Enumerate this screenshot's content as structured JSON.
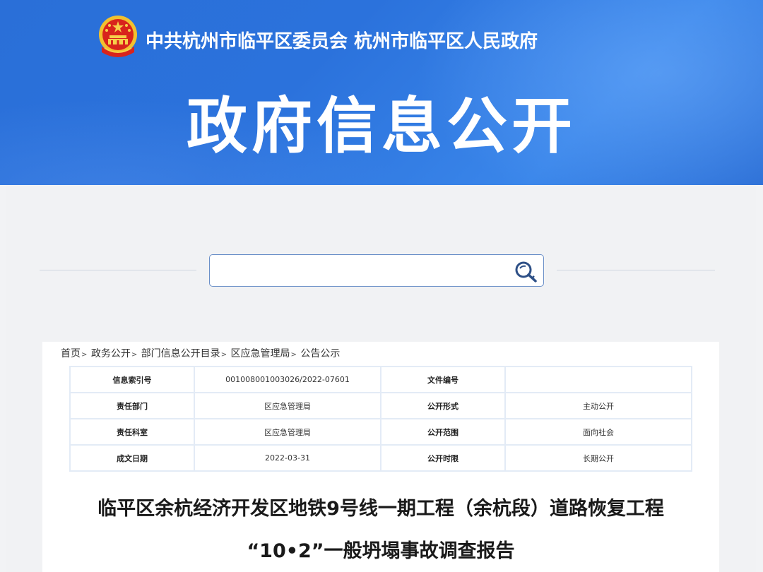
{
  "header": {
    "org_title": "中共杭州市临平区委员会  杭州市临平区人民政府",
    "main_title": "政府信息公开",
    "emblem_icon": "national-emblem-icon"
  },
  "search": {
    "value": "",
    "placeholder": "",
    "button_icon": "search-key-icon"
  },
  "breadcrumb": {
    "items": [
      "首页",
      "政务公开",
      "部门信息公开目录",
      "区应急管理局",
      "公告公示"
    ],
    "separator": ">"
  },
  "meta": {
    "rows": [
      {
        "label1": "信息索引号",
        "value1": "001008001003026/2022-07601",
        "label2": "文件编号",
        "value2": ""
      },
      {
        "label1": "责任部门",
        "value1": "区应急管理局",
        "label2": "公开形式",
        "value2": "主动公开"
      },
      {
        "label1": "责任科室",
        "value1": "区应急管理局",
        "label2": "公开范围",
        "value2": "面向社会"
      },
      {
        "label1": "成文日期",
        "value1": "2022-03-31",
        "label2": "公开时限",
        "value2": "长期公开"
      }
    ]
  },
  "document": {
    "title_line1": "临平区余杭经济开发区地铁9号线一期工程（余杭段）道路恢复工程",
    "title_line2": "“10•2”一般坍塌事故调查报告"
  },
  "colors": {
    "banner_blue": "#2b72dc",
    "table_border": "#e3ebf6",
    "search_border": "#6a8fc8"
  }
}
